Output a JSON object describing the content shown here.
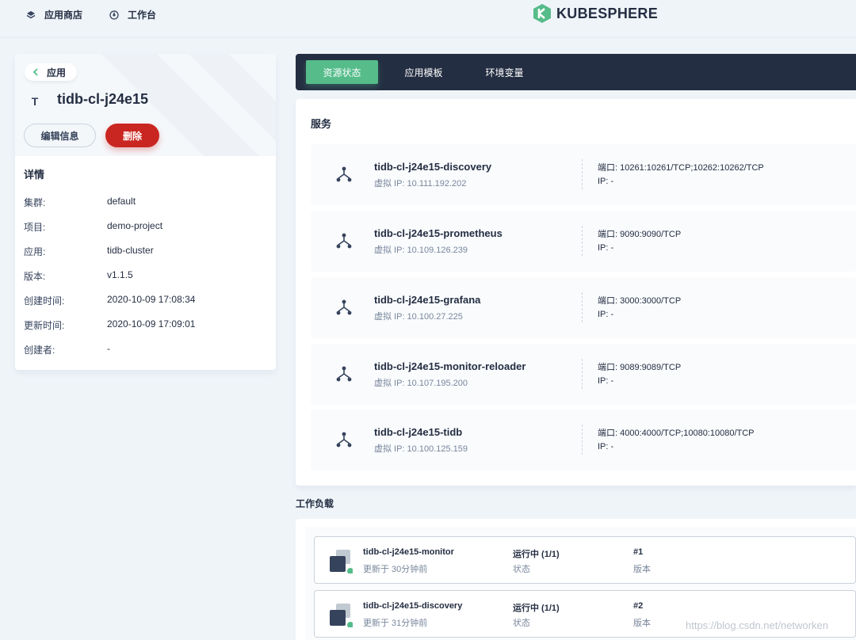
{
  "topnav": {
    "app_store": "应用商店",
    "workbench": "工作台",
    "brand": "KUBESPHERE"
  },
  "app": {
    "back_label": "应用",
    "icon_letter": "T",
    "name": "tidb-cl-j24e15",
    "edit_label": "编辑信息",
    "delete_label": "删除"
  },
  "details": {
    "title": "详情",
    "rows": [
      {
        "key": "集群:",
        "value": "default"
      },
      {
        "key": "项目:",
        "value": "demo-project"
      },
      {
        "key": "应用:",
        "value": "tidb-cluster"
      },
      {
        "key": "版本:",
        "value": "v1.1.5"
      },
      {
        "key": "创建时间:",
        "value": "2020-10-09 17:08:34"
      },
      {
        "key": "更新时间:",
        "value": "2020-10-09 17:09:01"
      },
      {
        "key": "创建者:",
        "value": "-"
      }
    ]
  },
  "tabs": [
    {
      "label": "资源状态",
      "active": true
    },
    {
      "label": "应用模板",
      "active": false
    },
    {
      "label": "环境变量",
      "active": false
    }
  ],
  "services": {
    "title": "服务",
    "items": [
      {
        "name": "tidb-cl-j24e15-discovery",
        "vip": "虚拟 IP: 10.111.192.202",
        "ports": "端口: 10261:10261/TCP;10262:10262/TCP",
        "ip": "IP: -"
      },
      {
        "name": "tidb-cl-j24e15-prometheus",
        "vip": "虚拟 IP: 10.109.126.239",
        "ports": "端口: 9090:9090/TCP",
        "ip": "IP: -"
      },
      {
        "name": "tidb-cl-j24e15-grafana",
        "vip": "虚拟 IP: 10.100.27.225",
        "ports": "端口: 3000:3000/TCP",
        "ip": "IP: -"
      },
      {
        "name": "tidb-cl-j24e15-monitor-reloader",
        "vip": "虚拟 IP: 10.107.195.200",
        "ports": "端口: 9089:9089/TCP",
        "ip": "IP: -"
      },
      {
        "name": "tidb-cl-j24e15-tidb",
        "vip": "虚拟 IP: 10.100.125.159",
        "ports": "端口: 4000:4000/TCP;10080:10080/TCP",
        "ip": "IP: -"
      }
    ]
  },
  "workloads": {
    "title": "工作负载",
    "items": [
      {
        "name": "tidb-cl-j24e15-monitor",
        "updated": "更新于 30分钟前",
        "status": "运行中 (1/1)",
        "status_label": "状态",
        "version": "#1",
        "version_label": "版本"
      },
      {
        "name": "tidb-cl-j24e15-discovery",
        "updated": "更新于 31分钟前",
        "status": "运行中 (1/1)",
        "status_label": "状态",
        "version": "#2",
        "version_label": "版本"
      }
    ]
  },
  "watermark": "https://blog.csdn.net/networken",
  "colors": {
    "accent": "#55bc8a",
    "danger": "#ca2621",
    "dark": "#242e42",
    "background": "#eff4f9"
  }
}
